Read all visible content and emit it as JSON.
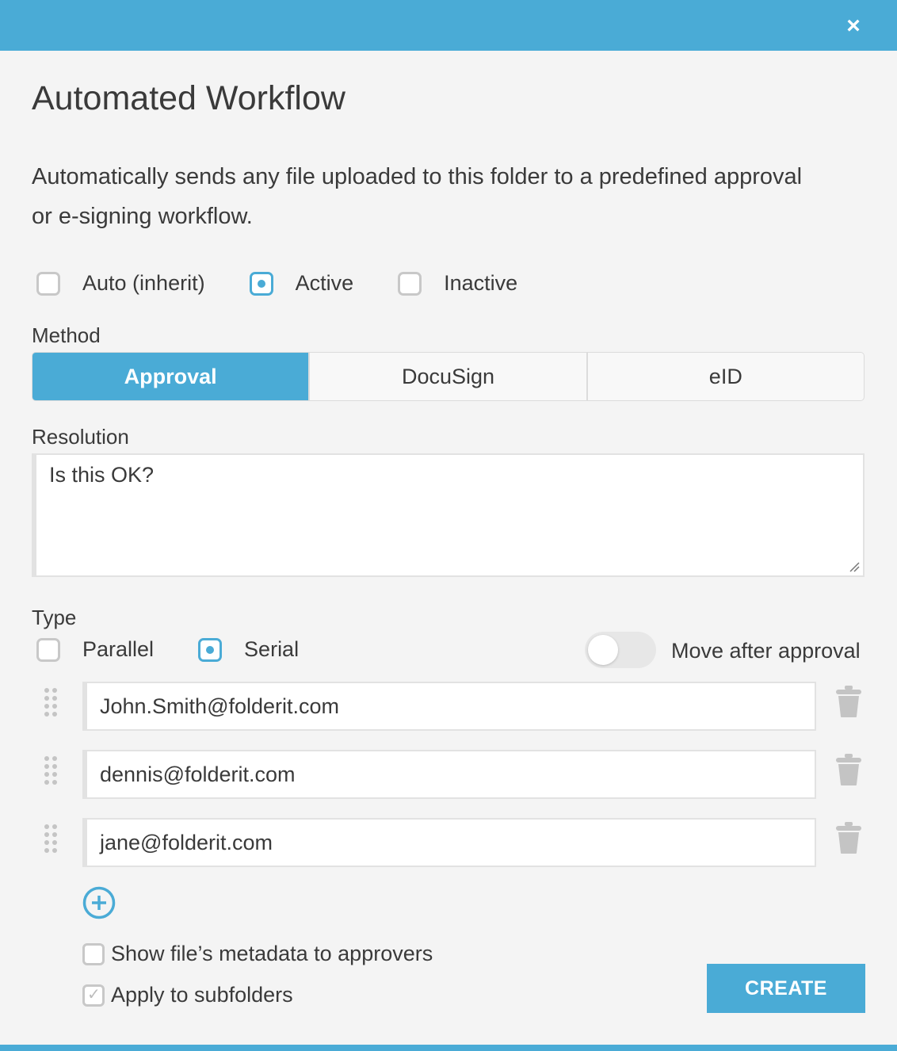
{
  "header": {
    "close_glyph": "×"
  },
  "title": "Automated Workflow",
  "description": "Automatically sends any file uploaded to this folder to a predefined approval or e-signing workflow.",
  "status": {
    "options": [
      {
        "label": "Auto (inherit)",
        "selected": false
      },
      {
        "label": "Active",
        "selected": true
      },
      {
        "label": "Inactive",
        "selected": false
      }
    ]
  },
  "method": {
    "label": "Method",
    "options": [
      "Approval",
      "DocuSign",
      "eID"
    ],
    "selected": "Approval"
  },
  "resolution": {
    "label": "Resolution",
    "value": "Is this OK?"
  },
  "type": {
    "label": "Type",
    "options": [
      {
        "label": "Parallel",
        "selected": false
      },
      {
        "label": "Serial",
        "selected": true
      }
    ],
    "move_after_approval": {
      "label": "Move after approval",
      "enabled": false
    }
  },
  "approvers": [
    "John.Smith@folderit.com",
    "dennis@folderit.com",
    "jane@folderit.com"
  ],
  "options": {
    "show_metadata": {
      "label": "Show file’s metadata to approvers",
      "checked": false
    },
    "apply_subfolders": {
      "label": "Apply to subfolders",
      "checked": true
    }
  },
  "create_label": "CREATE",
  "colors": {
    "accent": "#4aabd6",
    "text": "#3a3a3a",
    "background": "#f4f4f4"
  }
}
